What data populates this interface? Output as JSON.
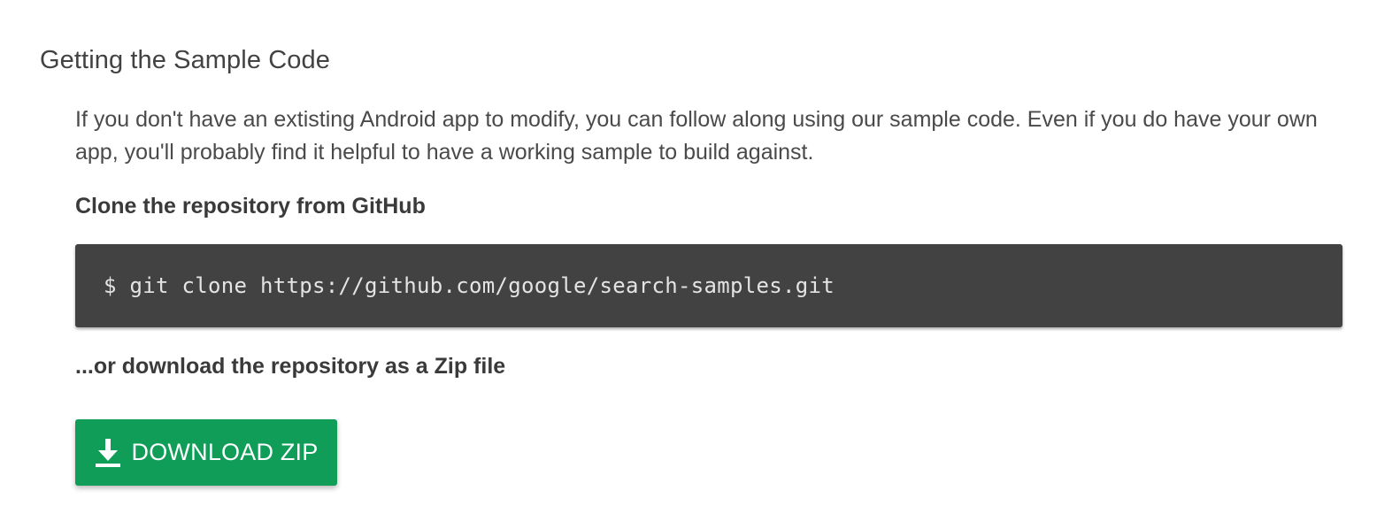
{
  "section": {
    "title": "Getting the Sample Code",
    "intro": "If you don't have an extisting Android app to modify, you can follow along using our sample code. Even if you do have your own app, you'll probably find it helpful to have a working sample to build against.",
    "clone_heading": "Clone the repository from GitHub",
    "clone_command": "$ git clone https://github.com/google/search-samples.git",
    "zip_heading": "...or download the repository as a Zip file",
    "download_button": {
      "label": "DOWNLOAD ZIP",
      "icon": "download-icon",
      "color": "#0f9d58"
    }
  },
  "colors": {
    "text": "#424242",
    "code_background": "#424242",
    "code_text": "#e4e4e4",
    "button_background": "#0f9d58",
    "button_text": "#ffffff"
  }
}
